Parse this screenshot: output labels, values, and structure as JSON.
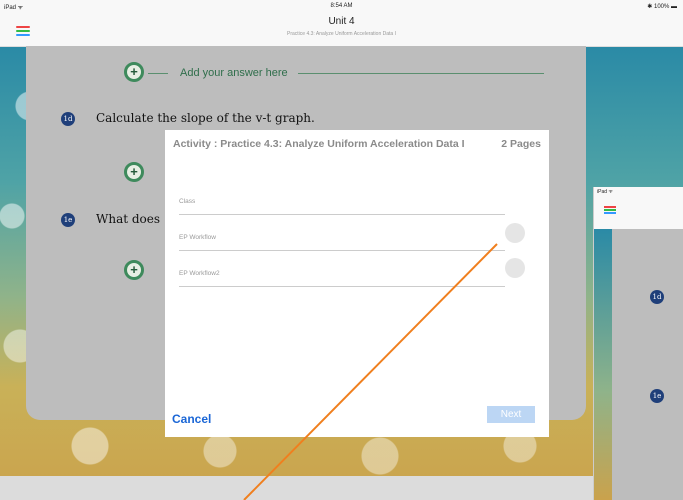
{
  "status": {
    "left": "iPad ᯤ",
    "time": "8:54 AM",
    "right": "✱ 100% ▬"
  },
  "nav": {
    "title": "Unit 4",
    "subtitle": "Practice 4.3: Analyze Uniform Acceleration Data I"
  },
  "colors": {
    "accent_blue": "#1a66d6",
    "badge_navy": "#1f3f7a",
    "plus_green": "#3e8a5c",
    "swipe_orange": "#f07f1e"
  },
  "questions": [
    {
      "badge": "1d",
      "text": "Calculate the slope of the v-t graph."
    },
    {
      "badge": "1e",
      "text": "What does"
    }
  ],
  "add_answer": "Add your answer here",
  "modal": {
    "title": "Activity : Practice 4.3: Analyze Uniform Acceleration Data I",
    "pages": "2 Pages",
    "rows": [
      {
        "label": "Class"
      },
      {
        "label": "EP Workflow"
      },
      {
        "label": "EP Workflow2"
      }
    ],
    "cancel": "Cancel",
    "next": "Next"
  },
  "side": {
    "status": "iPad ᯤ",
    "badges": [
      "1d",
      "1e"
    ]
  }
}
